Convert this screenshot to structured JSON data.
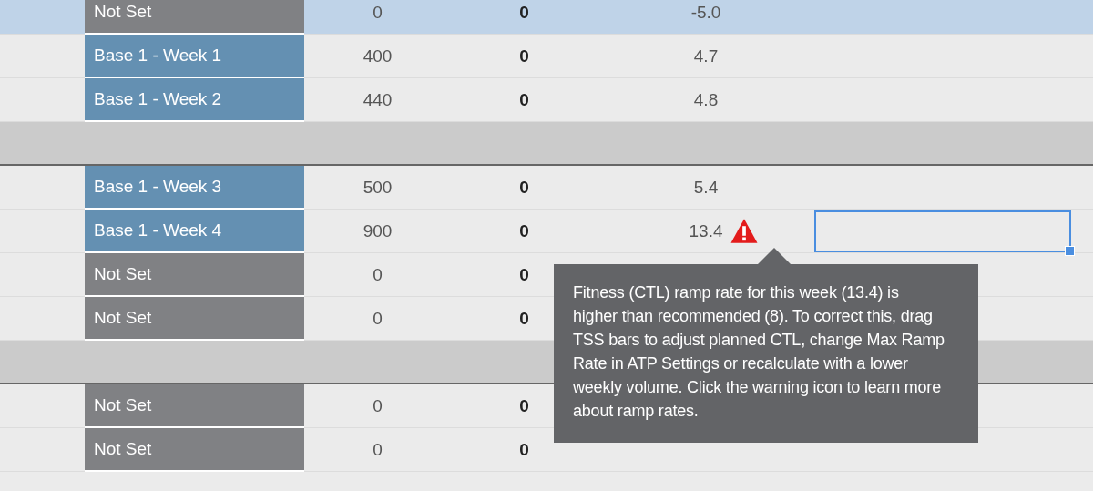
{
  "rows": [
    {
      "kind": "week",
      "label": "Not Set",
      "color": "#808184",
      "column_3": "0",
      "column_4": "0",
      "column_5": "-5.0",
      "selected": true,
      "warning": false,
      "focused": false
    },
    {
      "kind": "week",
      "label": "Base 1 - Week 1",
      "color": "#6490b2",
      "column_3": "400",
      "column_4": "0",
      "column_5": "4.7",
      "selected": false,
      "warning": false,
      "focused": false
    },
    {
      "kind": "week",
      "label": "Base 1 - Week 2",
      "color": "#6490b2",
      "column_3": "440",
      "column_4": "0",
      "column_5": "4.8",
      "selected": false,
      "warning": false,
      "focused": false
    },
    {
      "kind": "separator"
    },
    {
      "kind": "week",
      "label": "Base 1 - Week 3",
      "color": "#6490b2",
      "column_3": "500",
      "column_4": "0",
      "column_5": "5.4",
      "selected": false,
      "warning": false,
      "focused": false
    },
    {
      "kind": "week",
      "label": "Base 1 - Week 4",
      "color": "#6490b2",
      "column_3": "900",
      "column_4": "0",
      "column_5": "13.4",
      "selected": false,
      "warning": true,
      "focused": true
    },
    {
      "kind": "week",
      "label": "Not Set",
      "color": "#808184",
      "column_3": "0",
      "column_4": "0",
      "selected": false,
      "warning": false,
      "focused": false
    },
    {
      "kind": "week",
      "label": "Not Set",
      "color": "#808184",
      "column_3": "0",
      "column_4": "0",
      "selected": false,
      "warning": false,
      "focused": false
    },
    {
      "kind": "separator"
    },
    {
      "kind": "week",
      "label": "Not Set",
      "color": "#808184",
      "column_3": "0",
      "column_4": "0",
      "selected": false,
      "warning": false,
      "focused": false
    },
    {
      "kind": "week",
      "label": "Not Set",
      "color": "#808184",
      "column_3": "0",
      "column_4": "0",
      "selected": false,
      "warning": false,
      "focused": false
    }
  ],
  "tooltip": {
    "text": "Fitness (CTL) ramp rate for this week (13.4) is higher than recommended (8). To correct this, drag TSS bars to adjust planned CTL, change Max Ramp Rate in ATP Settings or recalculate with a lower weekly volume. Click the warning icon to learn more about ramp rates."
  }
}
